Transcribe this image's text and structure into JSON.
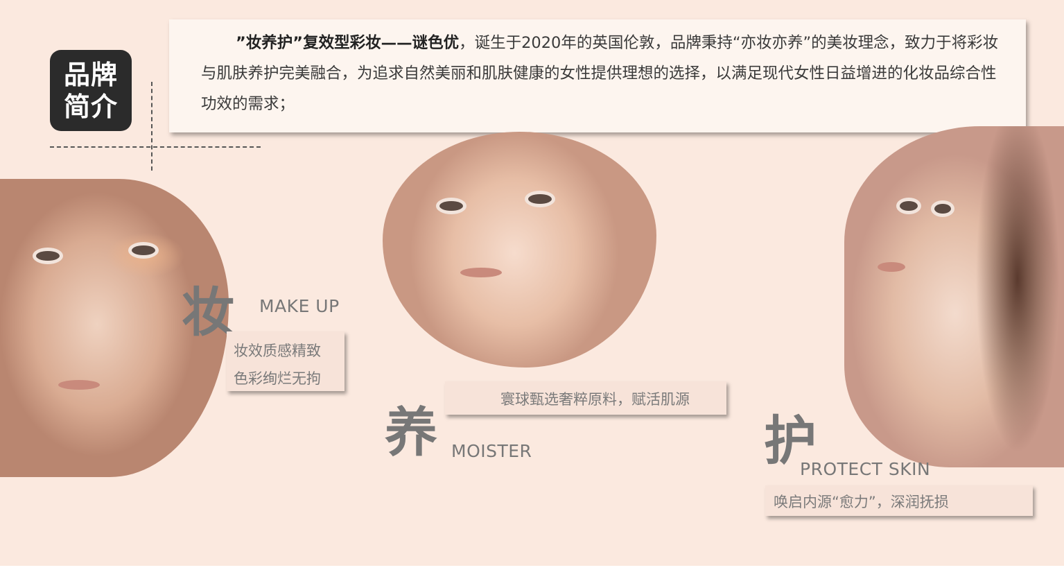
{
  "brand_badge": {
    "line1": "品牌",
    "line2": "简介"
  },
  "intro": {
    "bold_lead": "”妆养护”复效型彩妆——谜色优",
    "text": "，诞生于2020年的英国伦敦，品牌秉持“亦妆亦养”的美妆理念，致力于将彩妆与肌肤养护完美融合，为追求自然美丽和肌肤健康的女性提供理想的选择，以满足现代女性日益增进的化妆品综合性功效的需求；"
  },
  "sections": [
    {
      "char": "妆",
      "english": "MAKE UP",
      "desc_line1": "妆效质感精致",
      "desc_line2": "色彩绚烂无拘"
    },
    {
      "char": "养",
      "english": "MOISTER",
      "desc": "寰球甄选奢粹原料，赋活肌源"
    },
    {
      "char": "护",
      "english": "PROTECT SKIN",
      "desc": "唤启内源“愈力”，深润抚损"
    }
  ]
}
